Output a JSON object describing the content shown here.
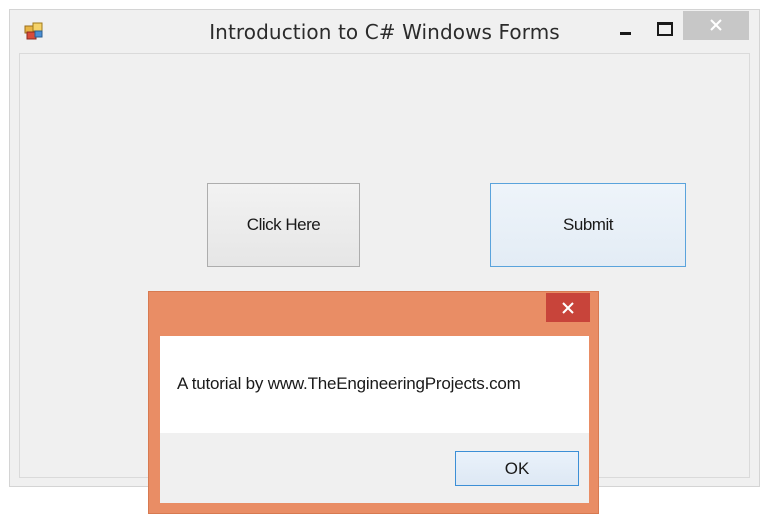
{
  "main_window": {
    "title": "Introduction to C# Windows Forms",
    "icon": "app-icon",
    "controls": {
      "minimize_icon": "minimize-icon",
      "maximize_icon": "maximize-icon",
      "close_icon": "close-icon"
    }
  },
  "form": {
    "buttons": {
      "click_here": "Click Here",
      "submit": "Submit"
    }
  },
  "message_box": {
    "message": "A tutorial by www.TheEngineeringProjects.com",
    "ok_label": "OK",
    "close_icon": "close-icon"
  },
  "colors": {
    "dialog_frame": "#e98d65",
    "dialog_close": "#c8443a",
    "window_background": "#f0f0f0",
    "focus_border": "#5aa3dc"
  }
}
